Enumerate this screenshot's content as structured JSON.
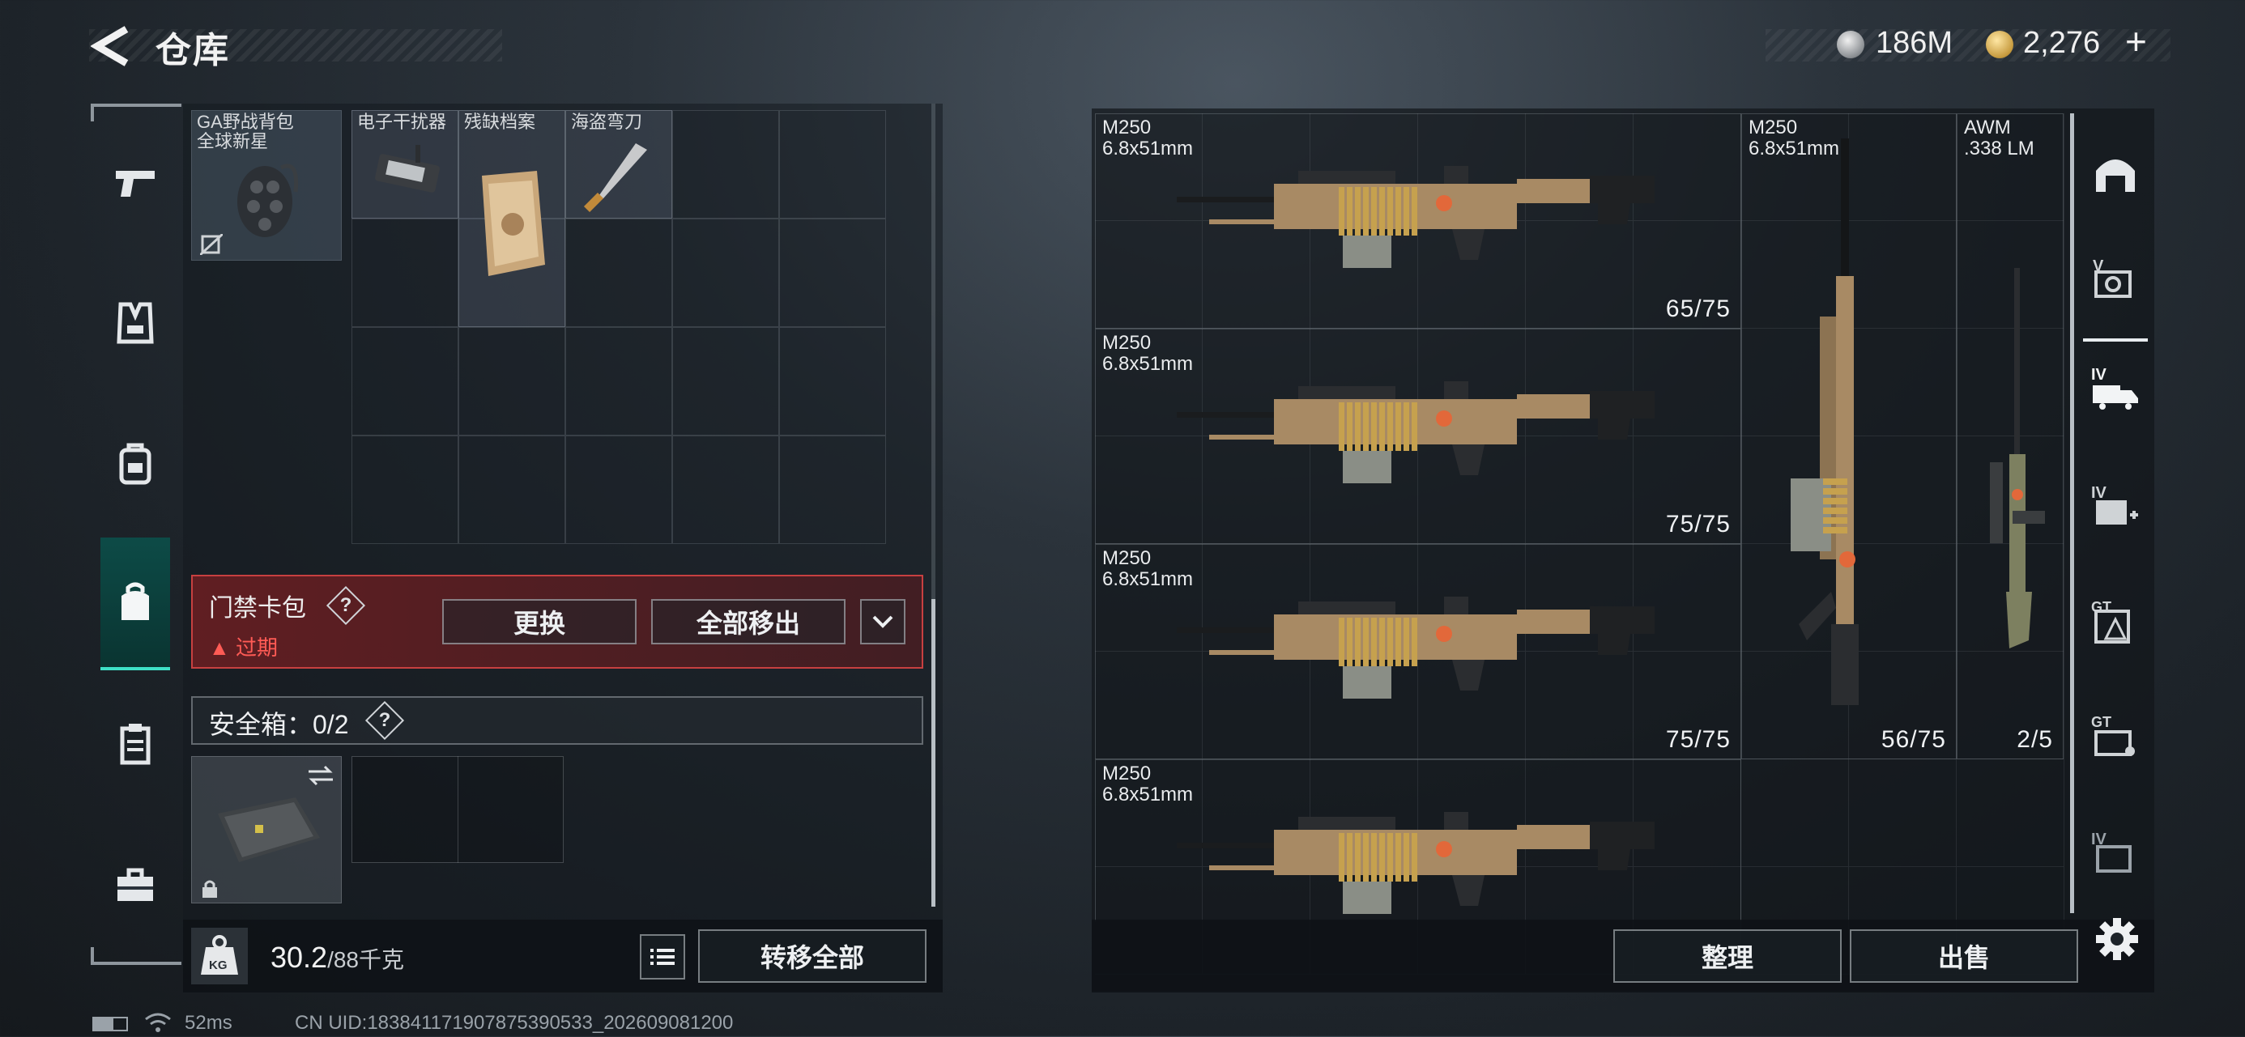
{
  "header": {
    "title": "仓库",
    "currency": [
      {
        "icon": "silver-coin-icon",
        "value": "186M"
      },
      {
        "icon": "gold-coin-icon",
        "value": "2,276"
      }
    ],
    "add_symbol": "+"
  },
  "sidebar": {
    "items": [
      {
        "name": "weapons",
        "icon": "pistol-icon"
      },
      {
        "name": "armor",
        "icon": "vest-icon"
      },
      {
        "name": "backpack-slot",
        "icon": "backpack-icon"
      },
      {
        "name": "bag",
        "icon": "bag-icon",
        "active": true
      },
      {
        "name": "tactical-rig",
        "icon": "rig-icon"
      },
      {
        "name": "toolbox",
        "icon": "briefcase-icon"
      }
    ]
  },
  "inventory": {
    "items": [
      {
        "label_line1": "GA野战背包",
        "label_line2": "全球新星"
      },
      {
        "label_line1": "电子干扰器"
      },
      {
        "label_line1": "残缺档案"
      },
      {
        "label_line1": "海盗弯刀"
      }
    ]
  },
  "keycard": {
    "title": "门禁卡包",
    "help": "?",
    "expired_icon": "warning-icon",
    "expired": "过期",
    "replace_label": "更换",
    "remove_all_label": "全部移出"
  },
  "safebox": {
    "label": "安全箱：0/2",
    "help": "?"
  },
  "weight": {
    "kg_label": "KG",
    "current": "30.2",
    "max": "/88千克"
  },
  "transfer_all_label": "转移全部",
  "warehouse": {
    "weapons": [
      {
        "name": "M250",
        "caliber": "6.8x51mm",
        "ammo": "65/75"
      },
      {
        "name": "M250",
        "caliber": "6.8x51mm",
        "ammo": "75/75"
      },
      {
        "name": "M250",
        "caliber": "6.8x51mm",
        "ammo": "75/75"
      },
      {
        "name": "M250",
        "caliber": "6.8x51mm",
        "ammo": ""
      },
      {
        "name": "M250",
        "caliber": "6.8x51mm",
        "ammo": "56/75"
      },
      {
        "name": "AWM",
        "caliber": ".338 LM",
        "ammo": "2/5"
      }
    ],
    "sort_label": "整理",
    "sell_label": "出售"
  },
  "right_tabs": [
    {
      "icon": "helmet-icon",
      "label": ""
    },
    {
      "icon": "camera-box-icon",
      "label": "V"
    },
    {
      "icon": "truck-icon",
      "label": "IV"
    },
    {
      "icon": "medkit-icon",
      "label": "IV"
    },
    {
      "icon": "hazard-box-icon",
      "label": "GT"
    },
    {
      "icon": "crate-icon",
      "label": "GT"
    },
    {
      "icon": "panel-icon",
      "label": "IV"
    }
  ],
  "status": {
    "ping": "52ms",
    "uid": "CN UID:18384117190787539053​3_202609081200"
  },
  "colors": {
    "accent_teal": "#3ee0c7",
    "warning_red": "#ff5b55",
    "keycard_border": "#c74040"
  }
}
